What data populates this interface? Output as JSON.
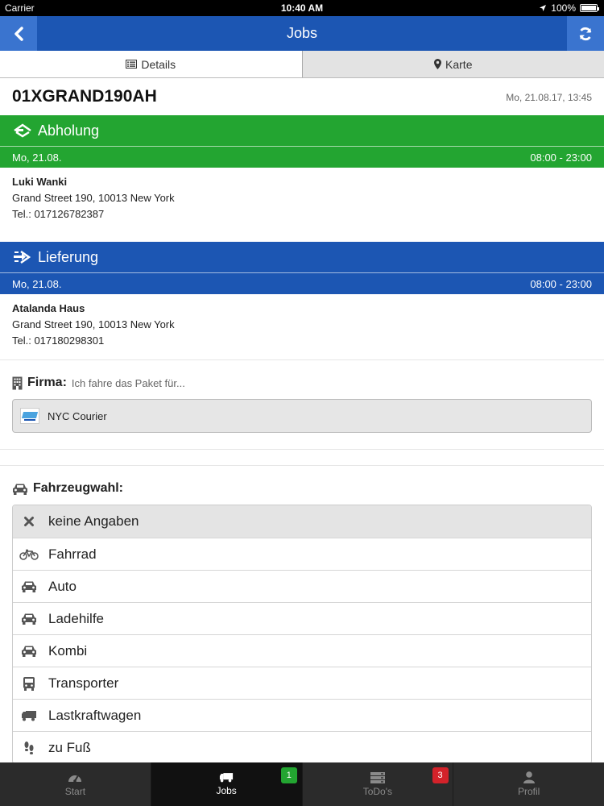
{
  "status_bar": {
    "carrier": "Carrier",
    "time": "10:40 AM",
    "battery": "100%"
  },
  "navbar": {
    "title": "Jobs"
  },
  "tabs": [
    {
      "label": "Details",
      "icon": "list-icon"
    },
    {
      "label": "Karte",
      "icon": "map-marker-icon"
    }
  ],
  "job": {
    "id": "01XGRAND190AH",
    "created": "Mo, 21.08.17, 13:45"
  },
  "pickup": {
    "title": "Abholung",
    "date": "Mo, 21.08.",
    "window": "08:00 - 23:00",
    "name": "Luki Wanki",
    "address": "Grand Street 190, 10013 New York",
    "phone": "Tel.: 017126782387"
  },
  "delivery": {
    "title": "Lieferung",
    "date": "Mo, 21.08.",
    "window": "08:00 - 23:00",
    "name": "Atalanda Haus",
    "address": "Grand Street 190, 10013 New York",
    "phone": "Tel.: 017180298301"
  },
  "firma": {
    "label": "Firma:",
    "hint": "Ich fahre das Paket für...",
    "value": "NYC Courier"
  },
  "vehicle": {
    "label": "Fahrzeugwahl:",
    "options": [
      {
        "label": "keine Angaben",
        "icon": "times-icon",
        "selected": true
      },
      {
        "label": "Fahrrad",
        "icon": "bicycle-icon"
      },
      {
        "label": "Auto",
        "icon": "car-icon"
      },
      {
        "label": "Ladehilfe",
        "icon": "car-icon"
      },
      {
        "label": "Kombi",
        "icon": "car-icon"
      },
      {
        "label": "Transporter",
        "icon": "bus-icon"
      },
      {
        "label": "Lastkraftwagen",
        "icon": "truck-icon"
      },
      {
        "label": "zu Fuß",
        "icon": "footprints-icon"
      }
    ]
  },
  "tabbar": [
    {
      "label": "Start",
      "icon": "dashboard-icon"
    },
    {
      "label": "Jobs",
      "icon": "truck-icon",
      "badge": "1",
      "active": true
    },
    {
      "label": "ToDo's",
      "icon": "server-icon",
      "badge": "3"
    },
    {
      "label": "Profil",
      "icon": "user-icon"
    }
  ],
  "colors": {
    "primary_blue": "#1c56b3",
    "pickup_green": "#23a531",
    "badge_red": "#d3222a"
  }
}
